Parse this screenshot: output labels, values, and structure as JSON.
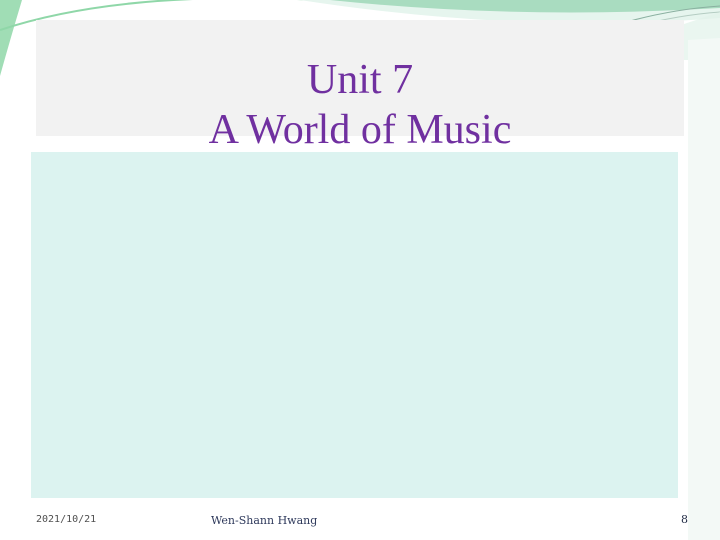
{
  "slide": {
    "title_line1": "Unit 7",
    "title_line2": "A World of Music"
  },
  "footer": {
    "date": "2021/10/21",
    "author": "Wen-Shann Hwang",
    "page_number": "8"
  },
  "colors": {
    "title": "#7030a0",
    "content_background": "#dcf3f0",
    "title_background": "#f2f2f2",
    "accent_green": "#8fd7a8"
  }
}
